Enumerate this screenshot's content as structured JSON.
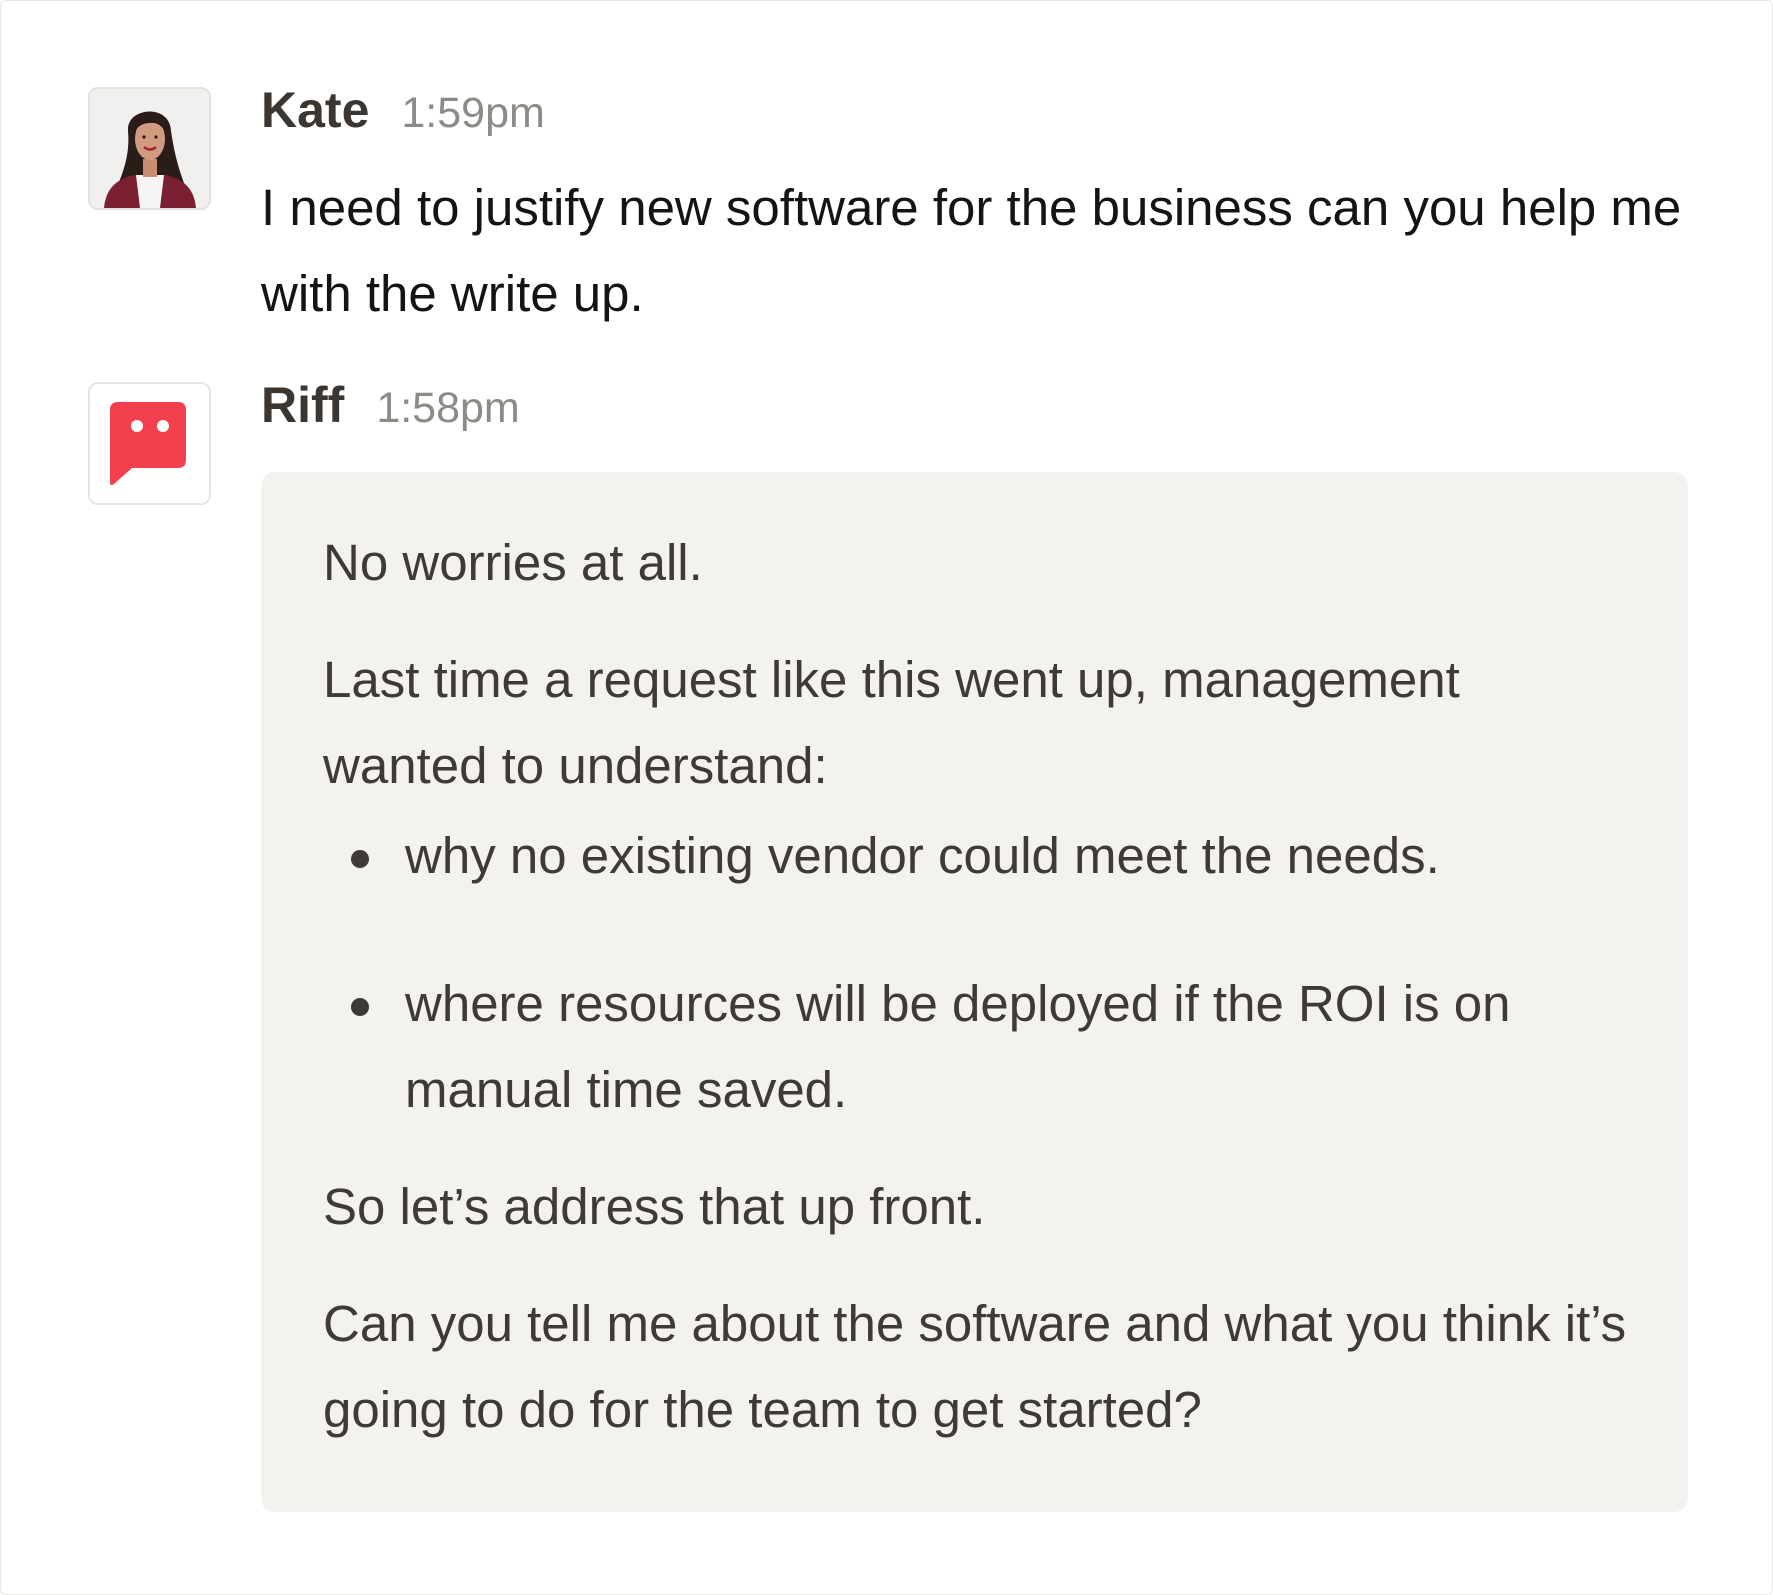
{
  "messages": [
    {
      "sender": "Kate",
      "time": "1:59pm",
      "avatar_icon": "user-photo",
      "text": "I need to justify new software for the business can you help me with the write up."
    },
    {
      "sender": "Riff",
      "time": "1:58pm",
      "avatar_icon": "chat-bubble-icon",
      "brand_color": "#f2404f",
      "bubble_color": "#f4f2ee",
      "paragraphs": {
        "intro": "No worries at all.",
        "context": "Last time a request like this went up, management wanted to understand:",
        "bullets": [
          "why no existing vendor could meet the needs.",
          "where resources will be deployed if the ROI is on manual time saved."
        ],
        "address": "So let’s address that up front.",
        "question": "Can you tell me about the software and what you think it’s going to do for the team to get started?"
      }
    }
  ]
}
